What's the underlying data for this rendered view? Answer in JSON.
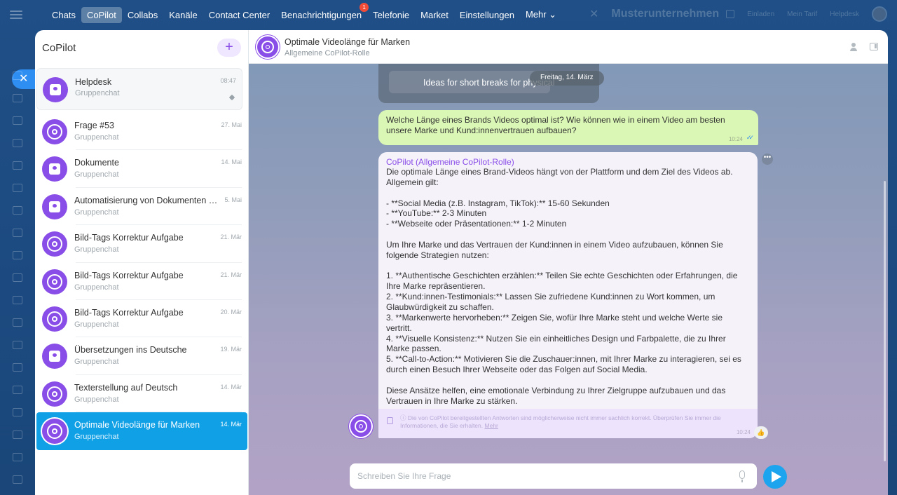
{
  "topnav": {
    "items": [
      {
        "label": "Chats"
      },
      {
        "label": "CoPilot",
        "active": true
      },
      {
        "label": "Collabs"
      },
      {
        "label": "Kanäle"
      },
      {
        "label": "Contact Center"
      },
      {
        "label": "Benachrichtigungen",
        "badge": "1"
      },
      {
        "label": "Telefonie"
      },
      {
        "label": "Market"
      },
      {
        "label": "Einstellungen"
      },
      {
        "label": "Mehr ⌄"
      }
    ],
    "org_name": "Musterunternehmen",
    "right_links": [
      "Einladen",
      "Mein Tarif",
      "Helpdesk"
    ]
  },
  "sidebar": {
    "title": "CoPilot",
    "add_label": "+",
    "chats": [
      {
        "name": "Helpdesk",
        "sub": "Gruppenchat",
        "date": "08:47",
        "icon": "document-icon",
        "pinned": true
      },
      {
        "name": "Frage #53",
        "sub": "Gruppenchat",
        "date": "27. Mai",
        "icon": "copilot-icon"
      },
      {
        "name": "Dokumente",
        "sub": "Gruppenchat",
        "date": "14. Mai",
        "icon": "document-icon"
      },
      {
        "name": "Automatisierung von Dokumenten in...",
        "sub": "Gruppenchat",
        "date": "5. Mai",
        "icon": "document-icon"
      },
      {
        "name": "Bild-Tags Korrektur Aufgabe",
        "sub": "Gruppenchat",
        "date": "21. Mär",
        "icon": "copilot-icon"
      },
      {
        "name": "Bild-Tags Korrektur Aufgabe",
        "sub": "Gruppenchat",
        "date": "21. Mär",
        "icon": "copilot-icon"
      },
      {
        "name": "Bild-Tags Korrektur Aufgabe",
        "sub": "Gruppenchat",
        "date": "20. Mär",
        "icon": "copilot-icon"
      },
      {
        "name": "Übersetzungen ins Deutsche",
        "sub": "Gruppenchat",
        "date": "19. Mär",
        "icon": "document-icon"
      },
      {
        "name": "Texterstellung auf Deutsch",
        "sub": "Gruppenchat",
        "date": "14. Mär",
        "icon": "copilot-icon"
      },
      {
        "name": "Optimale Videolänge für Marken",
        "sub": "Gruppenchat",
        "date": "14. Mär",
        "icon": "copilot-icon",
        "active": true
      }
    ]
  },
  "chat": {
    "title": "Optimale Videolänge für Marken",
    "subtitle": "Allgemeine CoPilot-Rolle",
    "previous_message": "Ideas for short breaks for physical",
    "date_divider": "Freitag, 14. März",
    "user_message": {
      "text": "Welche Länge eines Brands Videos optimal ist? Wie können wie in einem Video am besten unsere Marke und Kund:innenvertrauen aufbauen?",
      "time": "10:24"
    },
    "bot_message": {
      "sender": "CoPilot (Allgemeine CoPilot-Rolle)",
      "lines": [
        "Die optimale Länge eines Brand-Videos hängt von der Plattform und dem Ziel des Videos ab. Allgemein gilt:",
        "",
        "- **Social Media (z.B. Instagram, TikTok):** 15-60 Sekunden",
        "- **YouTube:** 2-3 Minuten",
        "- **Webseite oder Präsentationen:** 1-2 Minuten",
        "",
        "Um Ihre Marke und das Vertrauen der Kund:innen in einem Video aufzubauen, können Sie folgende Strategien nutzen:",
        "",
        "1. **Authentische Geschichten erzählen:** Teilen Sie echte Geschichten oder Erfahrungen, die Ihre Marke repräsentieren.",
        "2. **Kund:innen-Testimonials:** Lassen Sie zufriedene Kund:innen zu Wort kommen, um Glaubwürdigkeit zu schaffen.",
        "3. **Markenwerte hervorheben:** Zeigen Sie, wofür Ihre Marke steht und welche Werte sie vertritt.",
        "4. **Visuelle Konsistenz:** Nutzen Sie ein einheitliches Design und Farbpalette, die zu Ihrer Marke passen.",
        "5. **Call-to-Action:** Motivieren Sie die Zuschauer:innen, mit Ihrer Marke zu interagieren, sei es durch einen Besuch Ihrer Webseite oder das Folgen auf Social Media.",
        "",
        "Diese Ansätze helfen, eine emotionale Verbindung zu Ihrer Zielgruppe aufzubauen und das Vertrauen in Ihre Marke zu stärken."
      ],
      "disclaimer": "ⓘ Die von CoPilot bereitgestellten Antworten sind möglicherweise nicht immer sachlich korrekt. Überprüfen Sie immer die Informationen, die Sie erhalten.",
      "disclaimer_link": "Mehr",
      "time": "10:24"
    },
    "composer": {
      "placeholder": "Schreiben Sie Ihre Frage"
    }
  },
  "colors": {
    "accent": "#8a4ee8",
    "active_chat": "#10a0e6",
    "send": "#1da4ee",
    "outgoing_bubble": "#daf7b5"
  }
}
